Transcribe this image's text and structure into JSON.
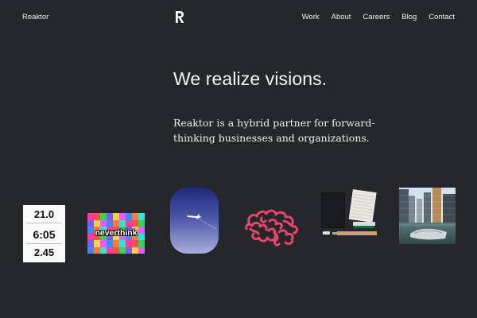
{
  "header": {
    "brand": "Reaktor",
    "logo_icon": "reaktor-r-logo-icon",
    "nav": [
      {
        "label": "Work"
      },
      {
        "label": "About"
      },
      {
        "label": "Careers"
      },
      {
        "label": "Blog"
      },
      {
        "label": "Contact"
      }
    ]
  },
  "hero": {
    "title": "We realize visions.",
    "subtitle": "Reaktor is a hybrid partner for forward-thinking businesses and organizations."
  },
  "tiles": {
    "stats": {
      "values": [
        "21.0",
        "6:05",
        "2.45"
      ]
    },
    "neverthink": {
      "word": "neverthink"
    },
    "icons": [
      "airplane-window-image",
      "brain-illustration",
      "notebook-desk-image",
      "city-harbor-image"
    ]
  },
  "colors": {
    "background": "#26272c",
    "text": "#f2f2f2",
    "brain": "#e8456a"
  }
}
